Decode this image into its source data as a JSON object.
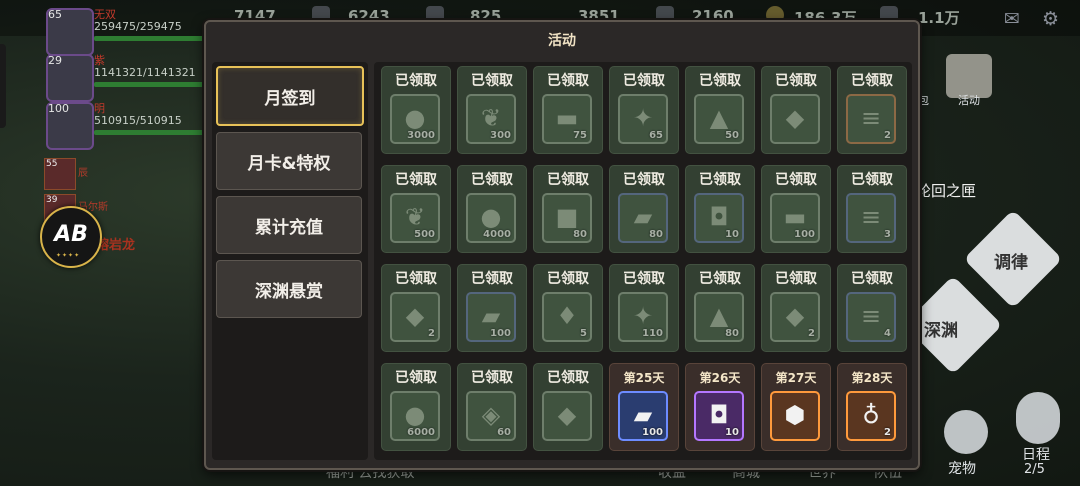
{
  "background": {
    "top_resources": [
      "7147",
      "6243",
      "825",
      "3851",
      "2160",
      "186.3万",
      "1.1万"
    ],
    "heroes": [
      {
        "level": "65",
        "name": "无双",
        "hp": "259475/259475"
      },
      {
        "level": "29",
        "name": "紫",
        "hp": "1141321/1141321"
      },
      {
        "level": "100",
        "name": "明",
        "hp": "510915/510915"
      }
    ],
    "small_heroes": [
      {
        "level": "55",
        "name": "辰"
      },
      {
        "level": "39",
        "name": "马尔斯"
      }
    ],
    "boss_label": "熔岩龙",
    "logo_text": "AB",
    "right_labels": {
      "activity": "活动",
      "reincarnation": "轮回之匣",
      "temper": "调律",
      "abyss": "深渊",
      "pet": "宠物",
      "schedule": "日程",
      "schedule_count": "2/5",
      "bag": "包"
    },
    "bottom_labels": [
      "福利  去找获取",
      "收益",
      "商城",
      "世界",
      "队伍"
    ]
  },
  "dialog": {
    "title": "活动",
    "tabs": [
      {
        "label": "月签到",
        "active": true
      },
      {
        "label": "月卡&特权",
        "active": false
      },
      {
        "label": "累计充值",
        "active": false
      },
      {
        "label": "深渊悬赏",
        "active": false
      }
    ],
    "claimed_label": "已领取",
    "rewards": [
      {
        "status": "claimed",
        "icon": "gold-coin-icon",
        "glyph": "●",
        "qty": "3000",
        "frame": "green"
      },
      {
        "status": "claimed",
        "icon": "wheat-icon",
        "glyph": "❦",
        "qty": "300",
        "frame": "green"
      },
      {
        "status": "claimed",
        "icon": "wood-logs-icon",
        "glyph": "▬",
        "qty": "75",
        "frame": "green"
      },
      {
        "status": "claimed",
        "icon": "crystal-cluster-icon",
        "glyph": "✦",
        "qty": "65",
        "frame": "green"
      },
      {
        "status": "claimed",
        "icon": "ore-pile-icon",
        "glyph": "▲",
        "qty": "50",
        "frame": "green"
      },
      {
        "status": "claimed",
        "icon": "mystery-crystal-icon",
        "glyph": "◆",
        "qty": "",
        "frame": "green"
      },
      {
        "status": "claimed",
        "icon": "scroll-icon",
        "glyph": "≡",
        "qty": "2",
        "frame": "orange"
      },
      {
        "status": "claimed",
        "icon": "wheat-icon",
        "glyph": "❦",
        "qty": "500",
        "frame": "green"
      },
      {
        "status": "claimed",
        "icon": "gold-coin-icon",
        "glyph": "●",
        "qty": "4000",
        "frame": "green"
      },
      {
        "status": "claimed",
        "icon": "stone-icon",
        "glyph": "■",
        "qty": "80",
        "frame": "green"
      },
      {
        "status": "claimed",
        "icon": "iron-ingot-icon",
        "glyph": "▰",
        "qty": "80",
        "frame": "blue"
      },
      {
        "status": "claimed",
        "icon": "bucket-icon",
        "glyph": "◘",
        "qty": "10",
        "frame": "blue"
      },
      {
        "status": "claimed",
        "icon": "wood-logs-icon",
        "glyph": "▬",
        "qty": "100",
        "frame": "green"
      },
      {
        "status": "claimed",
        "icon": "scroll-icon",
        "glyph": "≡",
        "qty": "3",
        "frame": "blue"
      },
      {
        "status": "claimed",
        "icon": "mystery-crystal-icon",
        "glyph": "◆",
        "qty": "2",
        "frame": "green"
      },
      {
        "status": "claimed",
        "icon": "iron-ingot-icon",
        "glyph": "▰",
        "qty": "100",
        "frame": "blue"
      },
      {
        "status": "claimed",
        "icon": "crystal-shard-icon",
        "glyph": "♦",
        "qty": "5",
        "frame": "green"
      },
      {
        "status": "claimed",
        "icon": "crystal-cluster-icon",
        "glyph": "✦",
        "qty": "110",
        "frame": "green"
      },
      {
        "status": "claimed",
        "icon": "ore-pile-icon",
        "glyph": "▲",
        "qty": "80",
        "frame": "green"
      },
      {
        "status": "claimed",
        "icon": "mystery-crystal-icon",
        "glyph": "◆",
        "qty": "2",
        "frame": "green"
      },
      {
        "status": "claimed",
        "icon": "scroll-icon",
        "glyph": "≡",
        "qty": "4",
        "frame": "blue"
      },
      {
        "status": "claimed",
        "icon": "gold-coin-icon",
        "glyph": "●",
        "qty": "6000",
        "frame": "green"
      },
      {
        "status": "claimed",
        "icon": "diamond-icon",
        "glyph": "◈",
        "qty": "60",
        "frame": "green"
      },
      {
        "status": "claimed",
        "icon": "mystery-crystal-icon",
        "glyph": "◆",
        "qty": "",
        "frame": "green"
      },
      {
        "status": "upcoming",
        "day_label": "第25天",
        "icon": "iron-ingot-icon",
        "glyph": "▰",
        "qty": "100",
        "frame": "up-blue"
      },
      {
        "status": "upcoming",
        "day_label": "第26天",
        "icon": "bucket-icon",
        "glyph": "◘",
        "qty": "10",
        "frame": "up-purple"
      },
      {
        "status": "upcoming",
        "day_label": "第27天",
        "icon": "white-stone-icon",
        "glyph": "⬢",
        "qty": "",
        "frame": "up-orange"
      },
      {
        "status": "upcoming",
        "day_label": "第28天",
        "icon": "potion-icon",
        "glyph": "♁",
        "qty": "2",
        "frame": "up-orange"
      }
    ]
  },
  "colors": {
    "accent": "#e8c258",
    "claimed_bg": "#334032",
    "upcoming_bg": "#3a2e2a"
  }
}
